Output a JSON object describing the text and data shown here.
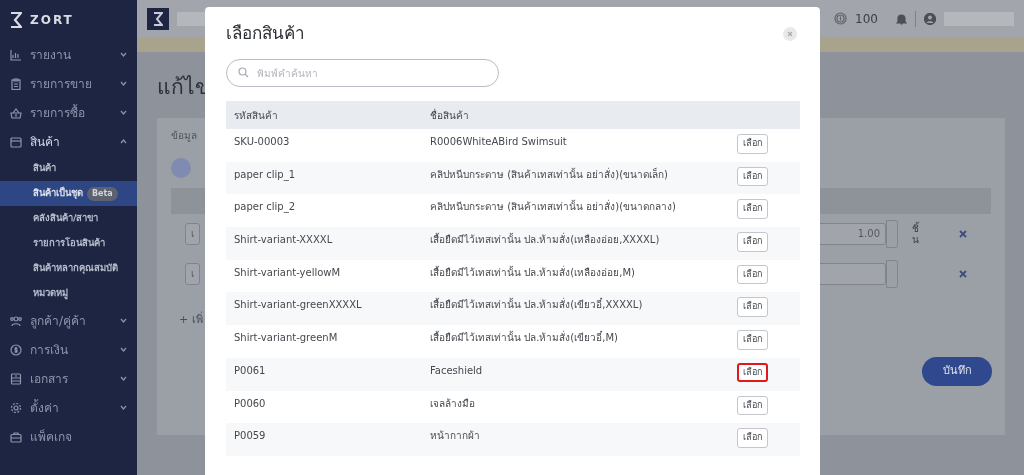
{
  "sidebar": {
    "logo": "ZORT",
    "items": [
      {
        "label": "รายงาน",
        "expanded": false
      },
      {
        "label": "รายการขาย",
        "expanded": false
      },
      {
        "label": "รายการซื้อ",
        "expanded": false
      },
      {
        "label": "สินค้า",
        "expanded": true,
        "children": [
          {
            "label": "สินค้า",
            "selected": false
          },
          {
            "label": "สินค้าเป็นชุด",
            "selected": true,
            "badge": "Beta"
          },
          {
            "label": "คลังสินค้า/สาขา",
            "selected": false
          },
          {
            "label": "รายการโอนสินค้า",
            "selected": false
          },
          {
            "label": "สินค้าหลากคุณสมบัติ",
            "selected": false
          },
          {
            "label": "หมวดหมู่",
            "selected": false
          }
        ]
      },
      {
        "label": "ลูกค้า/คู่ค้า",
        "expanded": false
      },
      {
        "label": "การเงิน",
        "expanded": false
      },
      {
        "label": "เอกสาร",
        "expanded": false
      },
      {
        "label": "ตั้งค่า",
        "expanded": false
      },
      {
        "label": "แพ็คเกจ"
      }
    ]
  },
  "topbar": {
    "credits": "100"
  },
  "page": {
    "title": "แก้ไข",
    "section_label": "ข้อมูล",
    "rows": [
      {
        "item": "เ",
        "quantity": "1.00",
        "unit": "ชิ้น"
      },
      {
        "item": "เ"
      }
    ],
    "add_link": "+ เพิ่",
    "save_button": "บันทึก"
  },
  "modal": {
    "title": "เลือกสินค้า",
    "search": {
      "placeholder": "พิมพ์คำค้นหา"
    },
    "table": {
      "columns": [
        "รหัสสินค้า",
        "ชื่อสินค้า"
      ],
      "rows": [
        {
          "code": "SKU-00003",
          "name": "R0006WhiteABird Swimsuit",
          "button": "เลือก",
          "highlighted": false
        },
        {
          "code": "paper clip_1",
          "name": "คลิปหนีบกระดาษ (สินค้าเทสเท่านั้น อย่าสั่ง)(ขนาดเล็ก)",
          "button": "เลือก",
          "highlighted": false
        },
        {
          "code": "paper clip_2",
          "name": "คลิปหนีบกระดาษ (สินค้าเทสเท่านั้น อย่าสั่ง)(ขนาดกลาง)",
          "button": "เลือก",
          "highlighted": false
        },
        {
          "code": "Shirt-variant-XXXXL",
          "name": "เสื้อยืดมีไว้เทสเท่านั้น ปล.ห้ามสั่ง(เหลืองอ่อย,XXXXL)",
          "button": "เลือก",
          "highlighted": false
        },
        {
          "code": "Shirt-variant-yellowM",
          "name": "เสื้อยืดมีไว้เทสเท่านั้น ปล.ห้ามสั่ง(เหลืองอ่อย,M)",
          "button": "เลือก",
          "highlighted": false
        },
        {
          "code": "Shirt-variant-greenXXXXL",
          "name": "เสื้อยืดมีไว้เทสเท่านั้น ปล.ห้ามสั่ง(เขียวอี๋,XXXXL)",
          "button": "เลือก",
          "highlighted": false
        },
        {
          "code": "Shirt-variant-greenM",
          "name": "เสื้อยืดมีไว้เทสเท่านั้น ปล.ห้ามสั่ง(เขียวอี๋,M)",
          "button": "เลือก",
          "highlighted": false
        },
        {
          "code": "P0061",
          "name": "Faceshield",
          "button": "เลือก",
          "highlighted": true
        },
        {
          "code": "P0060",
          "name": "เจลล้างมือ",
          "button": "เลือก",
          "highlighted": false
        },
        {
          "code": "P0059",
          "name": "หน้ากากผ้า",
          "button": "เลือก",
          "highlighted": false
        }
      ]
    }
  }
}
